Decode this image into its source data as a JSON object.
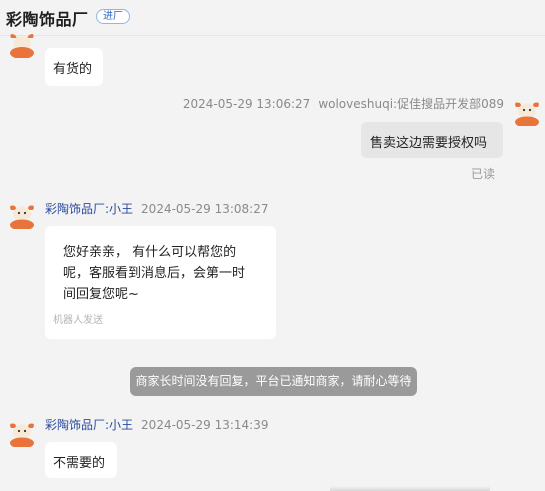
{
  "header": {
    "shop_title": "彩陶饰品厂",
    "enter_badge": "进厂"
  },
  "messages": [
    {
      "text": "有货的"
    },
    {
      "time": "2024-05-29 13:06:27",
      "sender": "woloveshuqi:促佳搜品开发部089",
      "text": "售卖这边需要授权吗",
      "read_status": "已读"
    },
    {
      "sender": "彩陶饰品厂:小王",
      "time": "2024-05-29 13:08:27",
      "text_lines": [
        "您好亲亲， 有什么可以帮您的",
        "呢，客服看到消息后，会第一时",
        "间回复您呢~"
      ],
      "bot_tag": "机器人发送"
    },
    {
      "system_notice": "商家长时间没有回复，平台已通知商家，请耐心等待"
    },
    {
      "sender": "彩陶饰品厂:小王",
      "time": "2024-05-29 13:14:39",
      "text": "不需要的"
    }
  ],
  "colors": {
    "background": "#f3f3f3",
    "sender_name": "#2a4aa0",
    "avatar_orange": "#e8743b",
    "system_notice_bg": "#9a9a9a"
  },
  "icons": [
    "bull-mascot-avatar"
  ]
}
